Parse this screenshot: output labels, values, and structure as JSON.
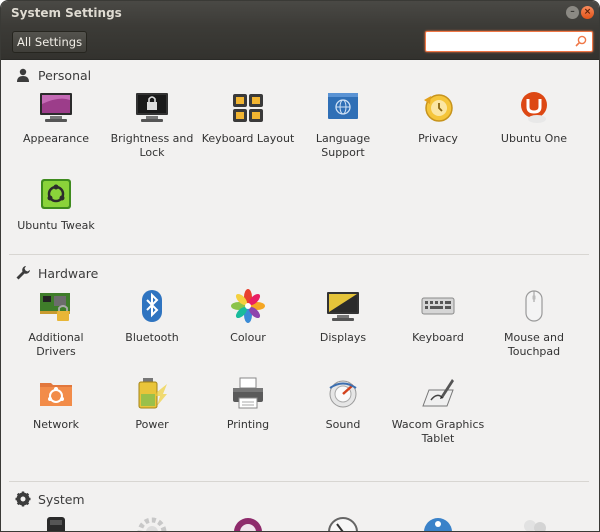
{
  "window": {
    "title": "System Settings",
    "minimize_icon": "minimize-icon",
    "close_icon": "close-icon"
  },
  "toolbar": {
    "all_settings_label": "All Settings",
    "search_value": "",
    "search_placeholder": "",
    "search_icon": "search-icon"
  },
  "sections": {
    "personal": {
      "title": "Personal",
      "icon": "person-icon",
      "items": [
        {
          "label": "Appearance",
          "icon": "appearance-icon"
        },
        {
          "label": "Brightness and Lock",
          "icon": "brightness-lock-icon"
        },
        {
          "label": "Keyboard Layout",
          "icon": "keyboard-layout-icon"
        },
        {
          "label": "Language Support",
          "icon": "language-support-icon"
        },
        {
          "label": "Privacy",
          "icon": "privacy-icon"
        },
        {
          "label": "Ubuntu One",
          "icon": "ubuntu-one-icon"
        },
        {
          "label": "Ubuntu Tweak",
          "icon": "ubuntu-tweak-icon"
        }
      ]
    },
    "hardware": {
      "title": "Hardware",
      "icon": "wrench-icon",
      "items": [
        {
          "label": "Additional Drivers",
          "icon": "additional-drivers-icon"
        },
        {
          "label": "Bluetooth",
          "icon": "bluetooth-icon"
        },
        {
          "label": "Colour",
          "icon": "colour-icon"
        },
        {
          "label": "Displays",
          "icon": "displays-icon"
        },
        {
          "label": "Keyboard",
          "icon": "keyboard-icon"
        },
        {
          "label": "Mouse and Touchpad",
          "icon": "mouse-touchpad-icon"
        },
        {
          "label": "Network",
          "icon": "network-icon"
        },
        {
          "label": "Power",
          "icon": "power-icon"
        },
        {
          "label": "Printing",
          "icon": "printing-icon"
        },
        {
          "label": "Sound",
          "icon": "sound-icon"
        },
        {
          "label": "Wacom Graphics Tablet",
          "icon": "wacom-tablet-icon"
        }
      ]
    },
    "system": {
      "title": "System",
      "icon": "gear-icon",
      "items": [
        {
          "label": "",
          "icon": "backups-icon"
        },
        {
          "label": "",
          "icon": "details-icon"
        },
        {
          "label": "",
          "icon": "landscape-icon"
        },
        {
          "label": "",
          "icon": "time-date-icon"
        },
        {
          "label": "",
          "icon": "universal-access-icon"
        },
        {
          "label": "",
          "icon": "user-accounts-icon"
        }
      ]
    }
  }
}
